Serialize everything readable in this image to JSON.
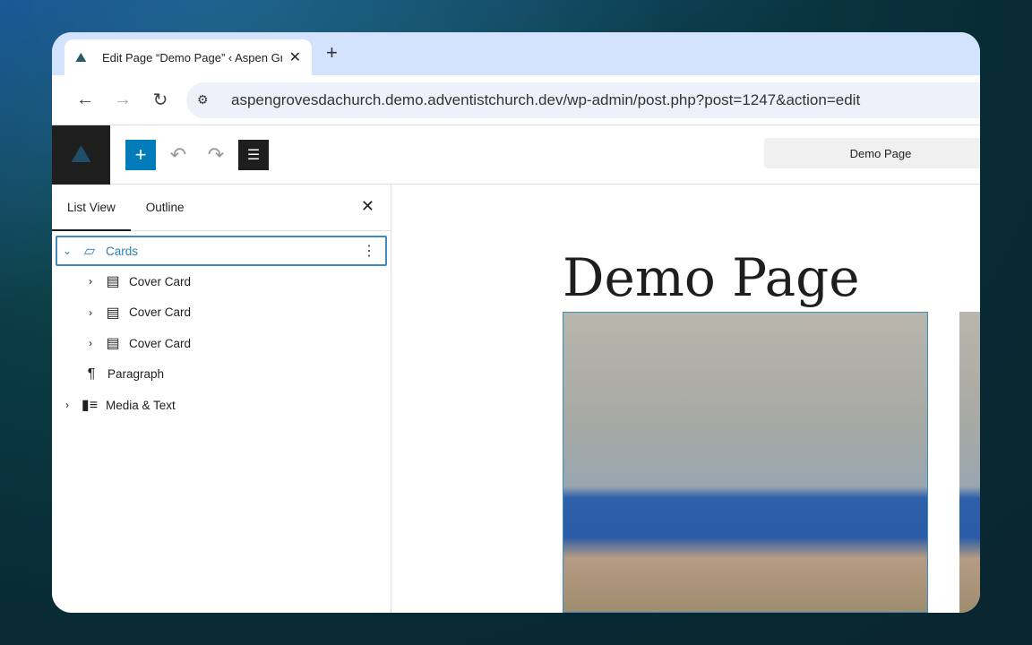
{
  "browser": {
    "tab_title": "Edit Page “Demo Page” ‹ Aspen Gr",
    "url": "aspengrovesdachurch.demo.adventistchurch.dev/wp-admin/post.php?post=1247&action=edit"
  },
  "editor": {
    "document_title": "Demo Page",
    "page_title": "Demo Page"
  },
  "sidebar": {
    "tabs": [
      "List View",
      "Outline"
    ],
    "items": [
      {
        "label": "Cards",
        "icon": "cards-icon",
        "expanded": true,
        "selected": true
      },
      {
        "label": "Cover Card",
        "icon": "cover-card-icon",
        "level": 2
      },
      {
        "label": "Cover Card",
        "icon": "cover-card-icon",
        "level": 2
      },
      {
        "label": "Cover Card",
        "icon": "cover-card-icon",
        "level": 2
      },
      {
        "label": "Paragraph",
        "icon": "paragraph-icon",
        "level": 1
      },
      {
        "label": "Media & Text",
        "icon": "media-text-icon",
        "level": 1
      }
    ]
  },
  "colors": {
    "accent": "#007cba",
    "selection": "#3e8bbf"
  }
}
